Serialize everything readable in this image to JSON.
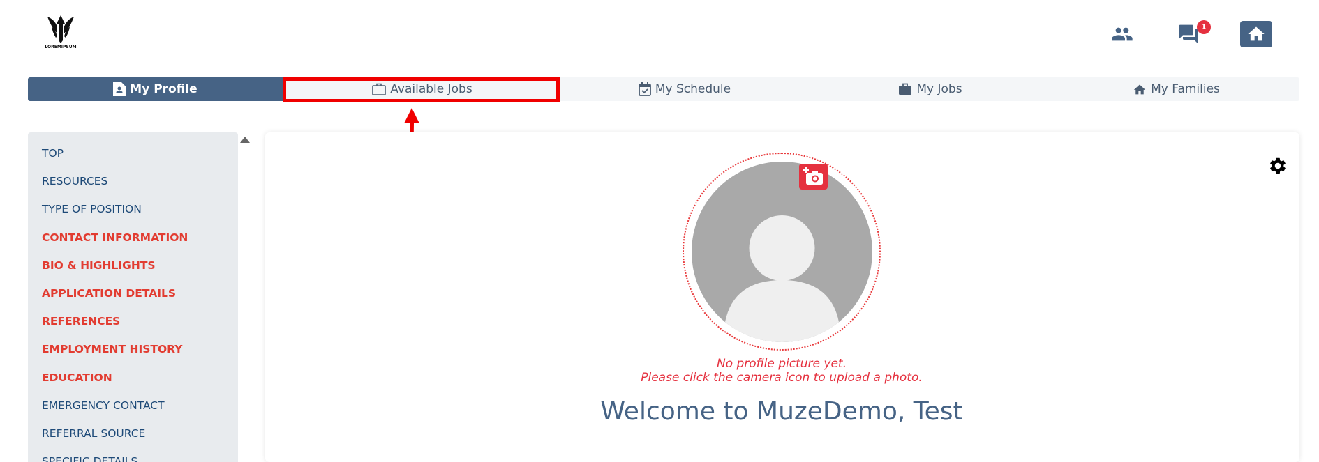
{
  "app": {
    "logo_text": "LOREMIPSUM"
  },
  "header": {
    "notification_count": "1"
  },
  "tabs": [
    {
      "label": "My Profile",
      "icon": "document-user-icon",
      "active": true
    },
    {
      "label": "Available Jobs",
      "icon": "briefcase-outline-icon",
      "active": false
    },
    {
      "label": "My Schedule",
      "icon": "calendar-check-icon",
      "active": false
    },
    {
      "label": "My Jobs",
      "icon": "briefcase-icon",
      "active": false
    },
    {
      "label": "My Families",
      "icon": "home-icon",
      "active": false
    }
  ],
  "sidebar": {
    "items": [
      {
        "label": "TOP",
        "status": "complete"
      },
      {
        "label": "RESOURCES",
        "status": "complete"
      },
      {
        "label": "TYPE OF POSITION",
        "status": "complete"
      },
      {
        "label": "CONTACT INFORMATION",
        "status": "incomplete"
      },
      {
        "label": "BIO & HIGHLIGHTS",
        "status": "incomplete"
      },
      {
        "label": "APPLICATION DETAILS",
        "status": "incomplete"
      },
      {
        "label": "REFERENCES",
        "status": "incomplete"
      },
      {
        "label": "EMPLOYMENT HISTORY",
        "status": "incomplete"
      },
      {
        "label": "EDUCATION",
        "status": "incomplete"
      },
      {
        "label": "EMERGENCY CONTACT",
        "status": "complete"
      },
      {
        "label": "REFERRAL SOURCE",
        "status": "complete"
      },
      {
        "label": "SPECIFIC DETAILS",
        "status": "complete"
      }
    ]
  },
  "profile": {
    "no_picture_line1": "No profile picture yet.",
    "no_picture_line2": "Please click the camera icon to upload a photo.",
    "welcome": "Welcome to MuzeDemo, Test"
  },
  "colors": {
    "primary": "#466385",
    "accent_red": "#e5313f",
    "sidebar_bg": "#e8ebee",
    "sidebar_link": "#1e4a78",
    "sidebar_incomplete": "#e23c31",
    "highlight_box": "#f00000"
  }
}
